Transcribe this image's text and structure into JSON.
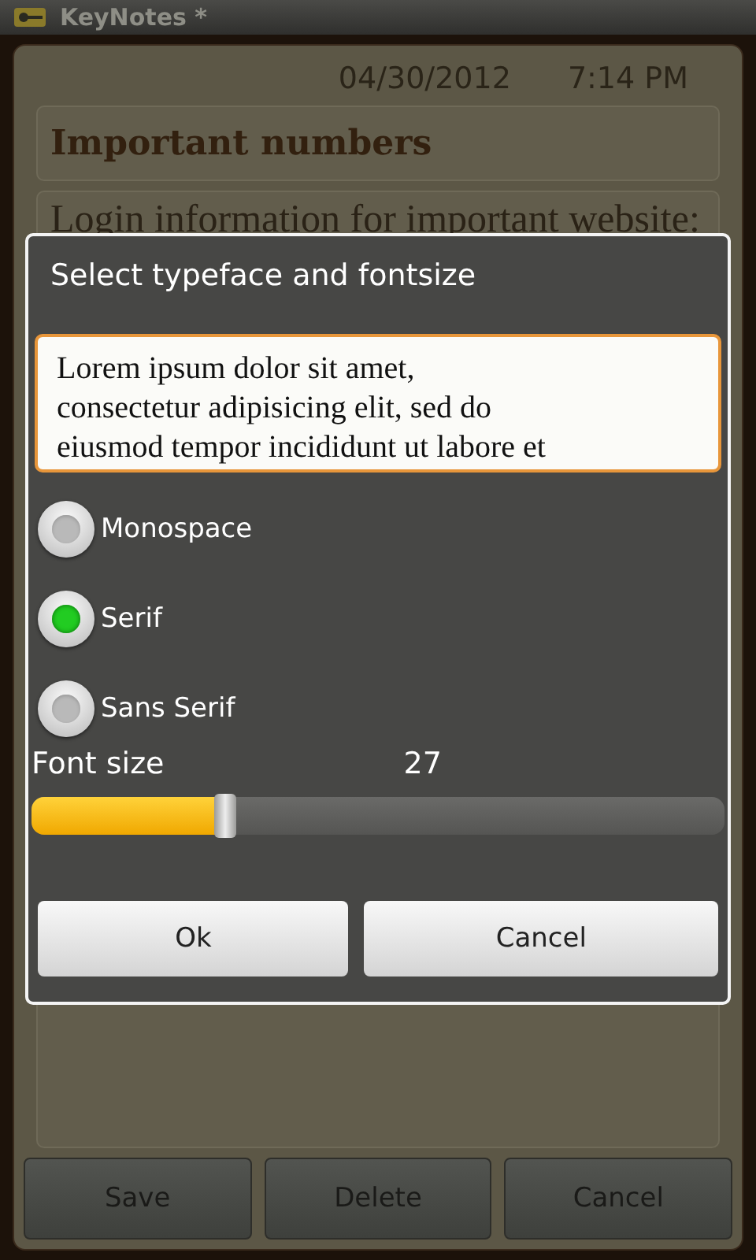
{
  "app": {
    "title": "KeyNotes *"
  },
  "note": {
    "date": "04/30/2012",
    "time": "7:14 PM",
    "title": "Important numbers",
    "body": "Login information for important website:"
  },
  "dialog": {
    "title": "Select typeface and fontsize",
    "preview": "Lorem ipsum dolor sit amet,\nconsectetur adipisicing elit, sed do\neiusmod tempor incididunt ut labore et",
    "typefaces": [
      {
        "label": "Monospace",
        "selected": false
      },
      {
        "label": "Serif",
        "selected": true
      },
      {
        "label": "Sans Serif",
        "selected": false
      }
    ],
    "font_size_label": "Font size",
    "font_size_value": "27",
    "font_size": {
      "level": 0.28
    },
    "buttons": [
      "Ok",
      "Cancel"
    ]
  },
  "actions": [
    "Save",
    "Delete",
    "Cancel"
  ]
}
